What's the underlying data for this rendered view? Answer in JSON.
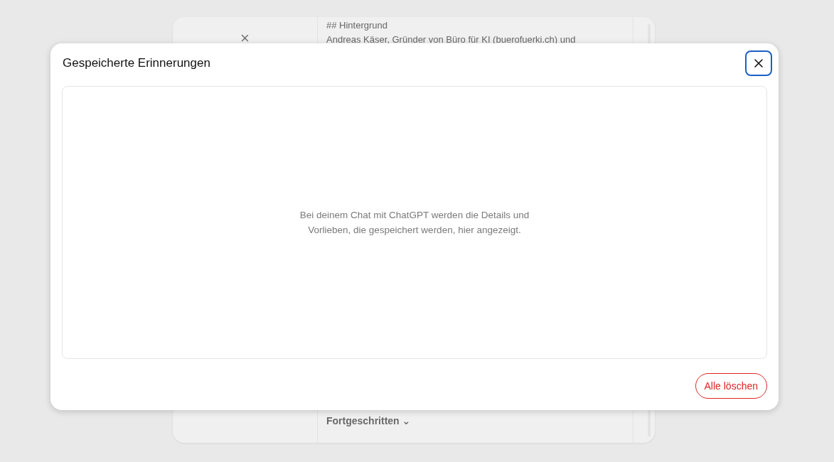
{
  "background_dialog": {
    "close_icon_text": "×",
    "text_lines": [
      "## Hintergrund",
      "Andreas Käser, Gründer von Büro für KI (buerofuerki.ch) und"
    ],
    "section_toggle": "Fortgeschritten",
    "section_caret": "⌄"
  },
  "modal": {
    "title": "Gespeicherte Erinnerungen",
    "empty_message": "Bei deinem Chat mit ChatGPT werden die Details und Vorlieben, die gespeichert werden, hier angezeigt.",
    "delete_all_button": "Alle löschen"
  }
}
